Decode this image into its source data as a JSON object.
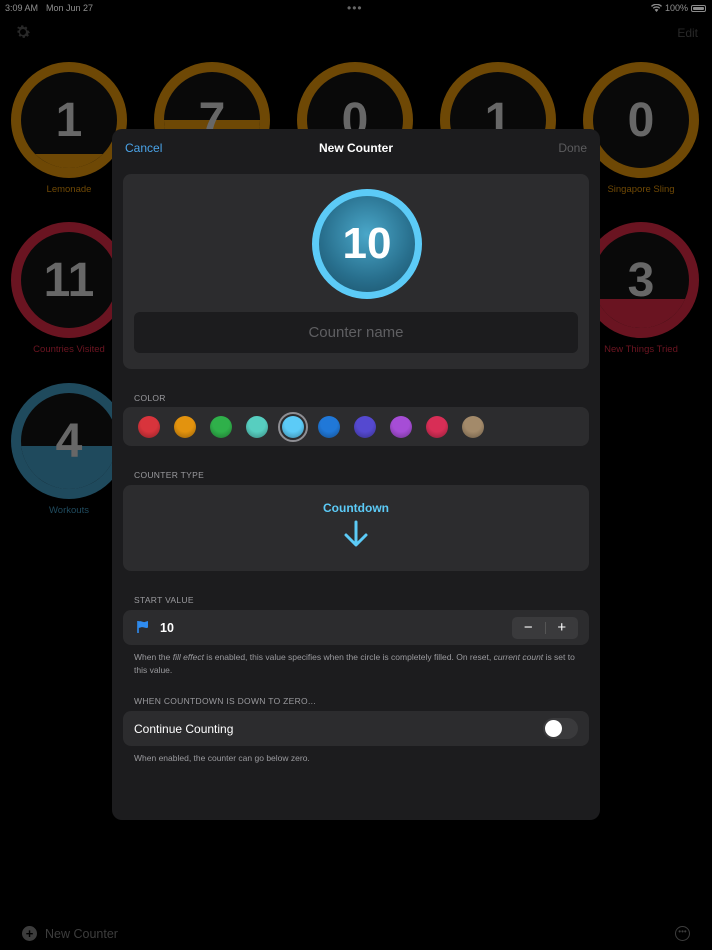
{
  "status_bar": {
    "time": "3:09 AM",
    "date": "Mon Jun 27",
    "battery": "100%"
  },
  "background": {
    "edit_label": "Edit",
    "new_counter_label": "New Counter",
    "counters": [
      {
        "value": "1",
        "label": "Lemonade",
        "color": "#c8830a",
        "fill": 0.15
      },
      {
        "value": "7",
        "label": "",
        "color": "#c8830a",
        "fill": 0.5
      },
      {
        "value": "0",
        "label": "",
        "color": "#c8830a",
        "fill": 0
      },
      {
        "value": "1",
        "label": "",
        "color": "#c8830a",
        "fill": 0.15
      },
      {
        "value": "0",
        "label": "Singapore Sling",
        "color": "#c8830a",
        "fill": 0
      },
      {
        "value": "11",
        "label": "Countries Visited",
        "color": "#c2263c",
        "fill": 0
      },
      {
        "value": "3",
        "label": "New Things Tried",
        "color": "#c2263c",
        "fill": 0.3
      },
      {
        "value": "4",
        "label": "Workouts",
        "color": "#3a87aa",
        "fill": 0.45
      }
    ]
  },
  "modal": {
    "cancel_label": "Cancel",
    "title": "New Counter",
    "done_label": "Done",
    "preview_value": "10",
    "name_placeholder": "Counter name",
    "color_section": "COLOR",
    "colors": [
      "#d8343c",
      "#e3930e",
      "#2fb04a",
      "#57cec0",
      "#5ccbf7",
      "#2078d8",
      "#5549d0",
      "#a64dd6",
      "#d82e56",
      "#a38a6a"
    ],
    "selected_color_index": 4,
    "type_section": "COUNTER TYPE",
    "type_label": "Countdown",
    "start_section": "START VALUE",
    "start_value": "10",
    "stepper_minus": "−",
    "stepper_plus": "+",
    "start_note_1": "When the ",
    "start_note_em1": "fill effect",
    "start_note_2": " is enabled, this value specifies when the circle is completely filled. On reset, ",
    "start_note_em2": "current count",
    "start_note_3": " is set to this value.",
    "zero_section": "WHEN COUNTDOWN IS DOWN TO ZERO...",
    "continue_label": "Continue Counting",
    "continue_enabled": false,
    "continue_note": "When enabled, the counter can go below zero."
  }
}
